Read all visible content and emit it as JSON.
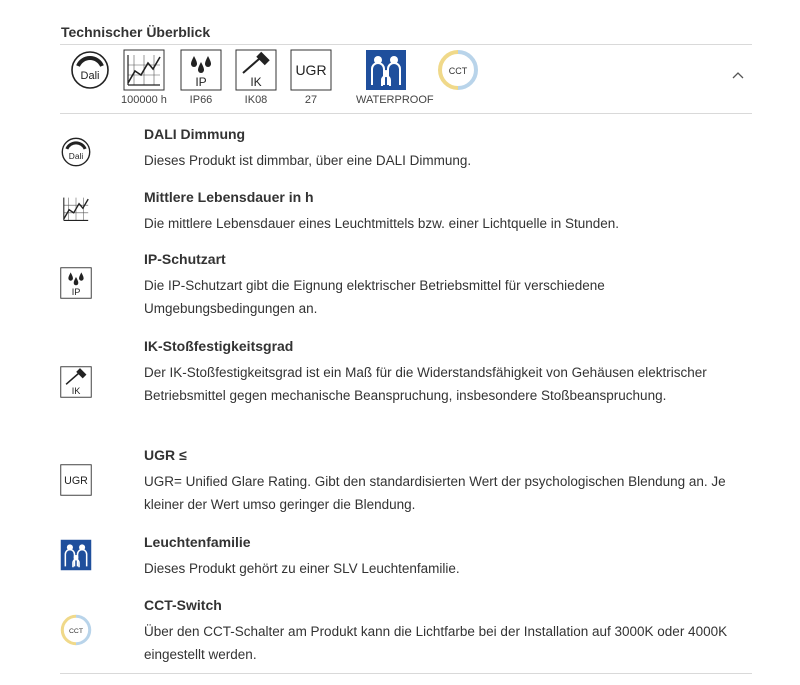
{
  "header": {
    "title": "Technischer Überblick"
  },
  "strip": [
    {
      "icon": "dali-icon",
      "caption": ""
    },
    {
      "icon": "lifetime-chart-icon",
      "caption": "100000 h"
    },
    {
      "icon": "ip-rating-icon",
      "caption": "IP66"
    },
    {
      "icon": "ik-rating-icon",
      "caption": "IK08"
    },
    {
      "icon": "ugr-icon",
      "caption": "27"
    },
    {
      "icon": "family-icon",
      "caption": "WATERPROOF"
    },
    {
      "icon": "cct-icon",
      "caption": ""
    }
  ],
  "icon_text": {
    "dali": "Dali",
    "ip": "IP",
    "ik": "IK",
    "ugr": "UGR",
    "cct": "CCT"
  },
  "colors": {
    "family_blue": "#1f4f9c",
    "cct_yellow": "#f0d98a",
    "cct_blue": "#b9d4ea",
    "divider": "#d9d9d9"
  },
  "details": [
    {
      "icon": "dali-icon",
      "title": "DALI Dimmung",
      "desc": "Dieses Produkt ist dimmbar, über eine DALI Dimmung."
    },
    {
      "icon": "lifetime-chart-icon",
      "title": "Mittlere Lebensdauer in h",
      "desc": "Die mittlere Lebensdauer eines Leuchtmittels bzw. einer Lichtquelle in Stunden."
    },
    {
      "icon": "ip-rating-icon",
      "title": "IP-Schutzart",
      "desc": "Die IP-Schutzart gibt die Eignung elektrischer Betriebsmittel für verschiedene Umgebungsbedingungen an."
    },
    {
      "icon": "ik-rating-icon",
      "title": "IK-Stoßfestigkeitsgrad",
      "desc": "Der IK-Stoßfestigkeitsgrad ist ein Maß für die Widerstandsfähigkeit von Gehäusen elektrischer Betriebsmittel gegen mechanische Beanspruchung, insbesondere Stoßbeanspruchung."
    },
    {
      "icon": "ugr-icon",
      "title": "UGR ≤",
      "desc": "UGR= Unified Glare Rating. Gibt den standardisierten Wert der psychologischen Blendung an. Je kleiner der Wert umso geringer die Blendung."
    },
    {
      "icon": "family-icon",
      "title": "Leuchtenfamilie",
      "desc": "Dieses Produkt gehört zu einer SLV Leuchtenfamilie."
    },
    {
      "icon": "cct-icon",
      "title": "CCT-Switch",
      "desc": "Über den CCT-Schalter am Produkt kann die Lichtfarbe bei der Installation auf 3000K oder 4000K eingestellt werden."
    }
  ]
}
